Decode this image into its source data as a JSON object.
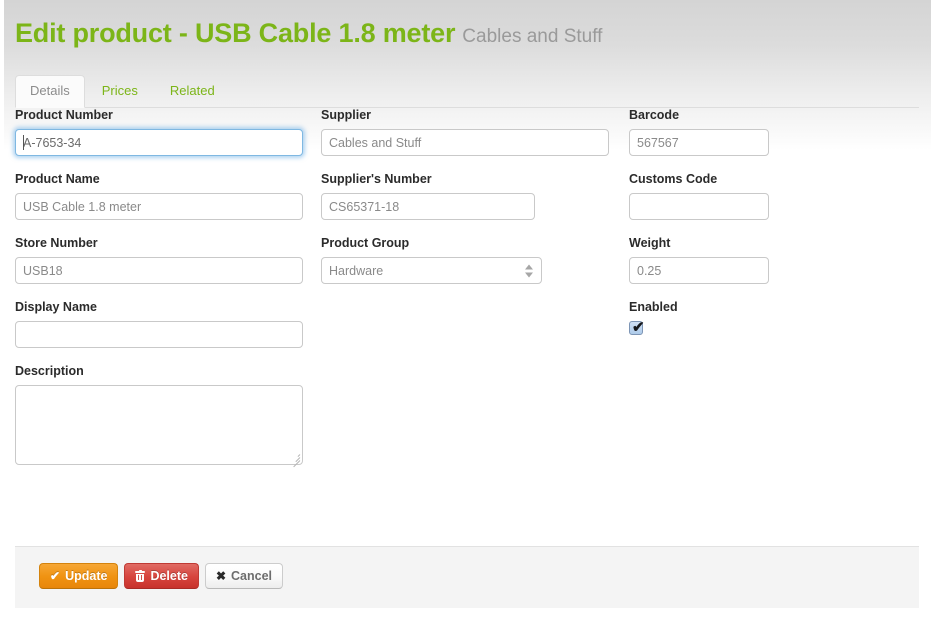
{
  "header": {
    "title": "Edit product - USB Cable 1.8 meter",
    "subtitle": "Cables and Stuff"
  },
  "tabs": [
    {
      "label": "Details",
      "active": true
    },
    {
      "label": "Prices",
      "active": false
    },
    {
      "label": "Related",
      "active": false
    }
  ],
  "form": {
    "column_1": {
      "product_number": {
        "label": "Product Number",
        "value": "A-7653-34",
        "placeholder": "",
        "focused": true
      },
      "product_name": {
        "label": "Product Name",
        "value": "",
        "placeholder": "USB Cable 1.8 meter"
      },
      "store_number": {
        "label": "Store Number",
        "value": "",
        "placeholder": "USB18"
      },
      "display_name": {
        "label": "Display Name",
        "value": "",
        "placeholder": ""
      },
      "description": {
        "label": "Description",
        "value": "",
        "placeholder": ""
      }
    },
    "column_2": {
      "supplier": {
        "label": "Supplier",
        "value": "",
        "placeholder": "Cables and Stuff"
      },
      "suppliers_number": {
        "label": "Supplier's Number",
        "value": "",
        "placeholder": "CS65371-18"
      },
      "product_group": {
        "label": "Product Group",
        "selected": "Hardware",
        "options": [
          "Hardware"
        ]
      }
    },
    "column_3": {
      "barcode": {
        "label": "Barcode",
        "value": "",
        "placeholder": "567567"
      },
      "customs_code": {
        "label": "Customs Code",
        "value": "",
        "placeholder": ""
      },
      "weight": {
        "label": "Weight",
        "value": "",
        "placeholder": "0.25"
      },
      "enabled": {
        "label": "Enabled",
        "checked": true,
        "tick": "✔"
      }
    }
  },
  "footer": {
    "update_label": "Update",
    "update_icon": "check-icon",
    "update_glyph": "✔",
    "delete_label": "Delete",
    "delete_icon": "trash-icon",
    "cancel_label": "Cancel",
    "cancel_icon": "close-icon",
    "cancel_glyph": "✖"
  },
  "colors": {
    "accent_green": "#7cb518",
    "update_orange": "#f09312",
    "delete_red": "#d7453e",
    "focus_blue": "#7fb8e2"
  }
}
